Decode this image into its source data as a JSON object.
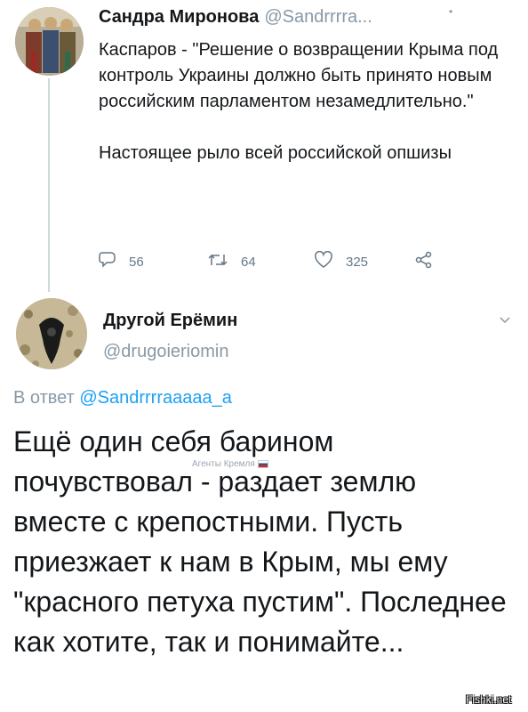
{
  "tweet1": {
    "name": "Сандра Миронова",
    "handle": "@Sandrrrra...",
    "text_quote": "Каспаров  - \"Решение о возвращении Крыма под контроль Украины должно быть принято новым российским парламентом незамедлительно.\"",
    "text_comment": "Настоящее рыло всей российской опшизы",
    "replies": "56",
    "retweets": "64",
    "likes": "325"
  },
  "tweet2": {
    "name": "Другой Ерёмин",
    "handle": "@drugoieriomin",
    "reply_prefix": "В ответ",
    "reply_mention": "@Sandrrrraaaaa_a",
    "text": "Ещё один себя барином почувствовал - раздает землю вместе с крепостными. Пусть приезжает к нам в Крым, мы ему \"красного петуха пустим\". Последнее как хотите, так и понимайте..."
  },
  "overlay_watermark": "Агенты Кремля",
  "site_watermark": "Fishki.net",
  "icons": [
    "reply-icon",
    "retweet-icon",
    "like-icon",
    "share-icon",
    "chevron-down-icon"
  ],
  "colors": {
    "text": "#14171a",
    "secondary": "#8899a6",
    "link": "#1da1f2",
    "icon": "#657786"
  }
}
